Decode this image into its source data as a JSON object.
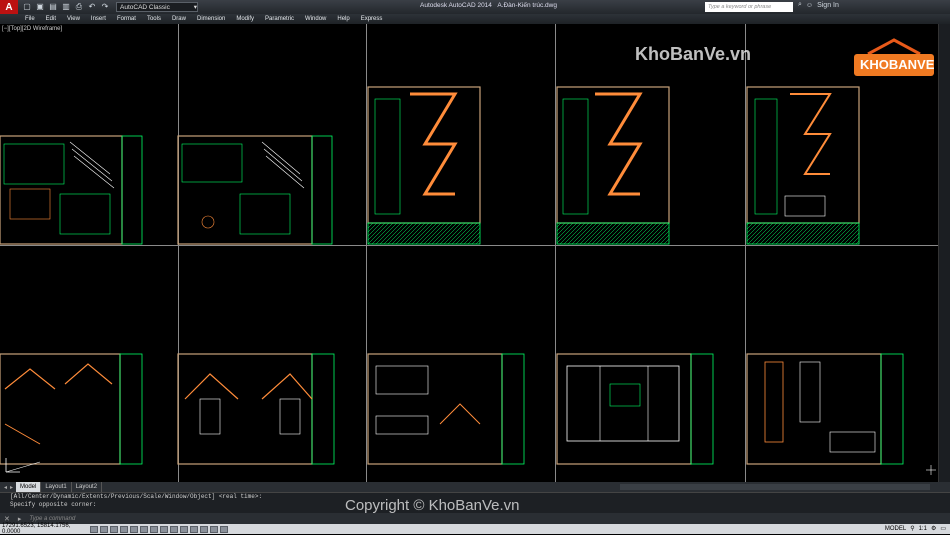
{
  "titlebar": {
    "logo_letter": "A",
    "workspace": "AutoCAD Classic",
    "app_title": "Autodesk AutoCAD 2014",
    "file_name": "A.Đàn-Kiến trúc.dwg",
    "search_placeholder": "Type a keyword or phrase",
    "sign_in": "Sign In"
  },
  "menu": [
    "File",
    "Edit",
    "View",
    "Insert",
    "Format",
    "Tools",
    "Draw",
    "Dimension",
    "Modify",
    "Parametric",
    "Window",
    "Help",
    "Express"
  ],
  "viewport": {
    "label": "[−][Top][2D Wireframe]"
  },
  "watermark": {
    "top": "KhoBanVe.vn",
    "logo": "KHOBANVE",
    "bottom": "Copyright © KhoBanVe.vn"
  },
  "tabs": [
    "Model",
    "Layout1",
    "Layout2"
  ],
  "command": {
    "history": [
      "[All/Center/Dynamic/Extents/Previous/Scale/Window/Object] <real time>:",
      "Specify opposite corner:"
    ],
    "placeholder": "Type a command"
  },
  "status": {
    "coords": "17291.6523, 15814.1756, 0.0000",
    "model": "MODEL",
    "scale": "1:1"
  },
  "colors": {
    "sheet_border": "#c8a27a",
    "cad_green": "#00ff66",
    "cad_orange": "#ff8c3a"
  }
}
